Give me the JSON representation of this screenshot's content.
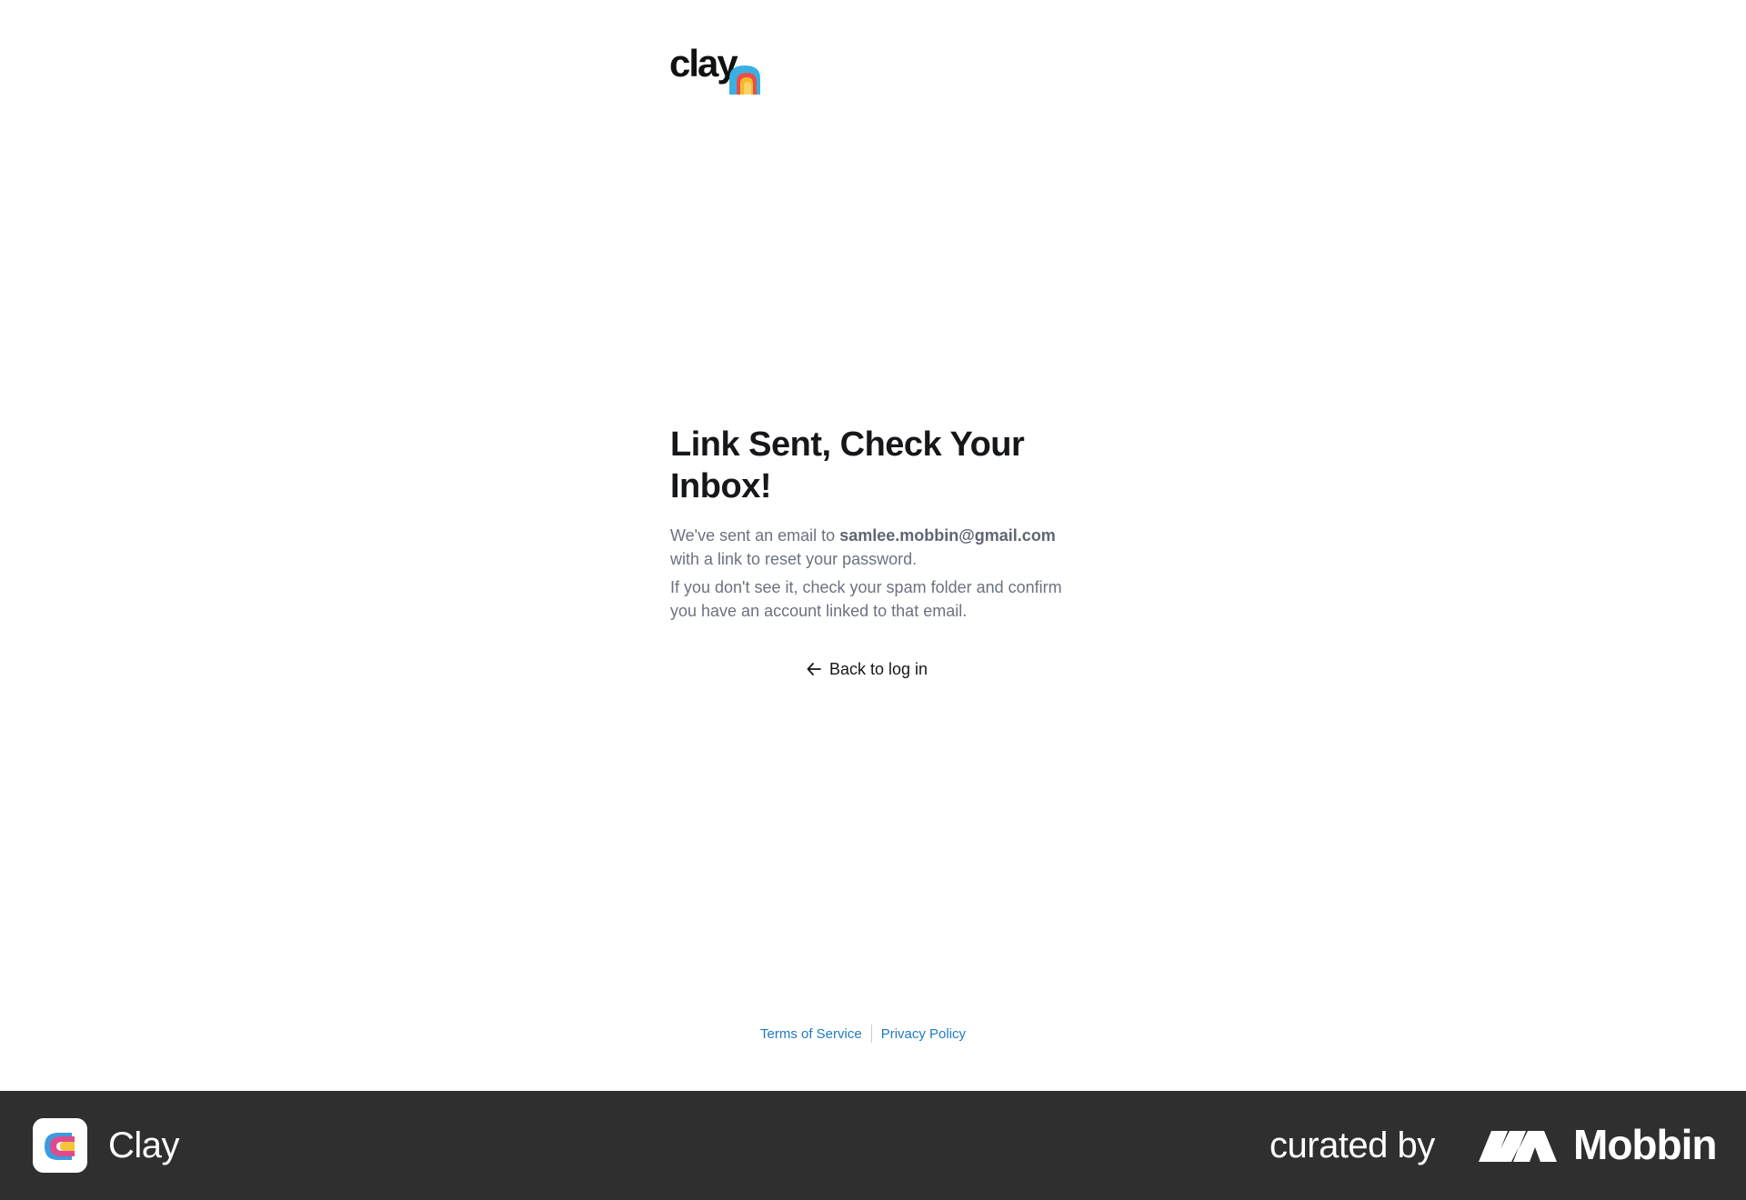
{
  "brand": {
    "logo_text": "clay"
  },
  "main": {
    "title": "Link Sent, Check Your Inbox!",
    "desc_prefix": "We've sent an email to ",
    "email": "samlee.mobbin@gmail.com",
    "desc_suffix": " with a link to reset your password.",
    "spam_note": "If you don't see it, check your spam folder and confirm you have an account linked to that email.",
    "back_label": "Back to log in"
  },
  "footer": {
    "terms": "Terms of Service",
    "privacy": "Privacy Policy",
    "link_color": "#1f7ac1"
  },
  "banner": {
    "app_name": "Clay",
    "curated_by": "curated by",
    "mobbin": "Mobbin",
    "background": "#2f2f2f"
  },
  "icons": {
    "back": "arrow-left-icon",
    "logo": "clay-arch-icon",
    "app": "clay-app-icon",
    "mobbin": "mobbin-logo-icon"
  }
}
